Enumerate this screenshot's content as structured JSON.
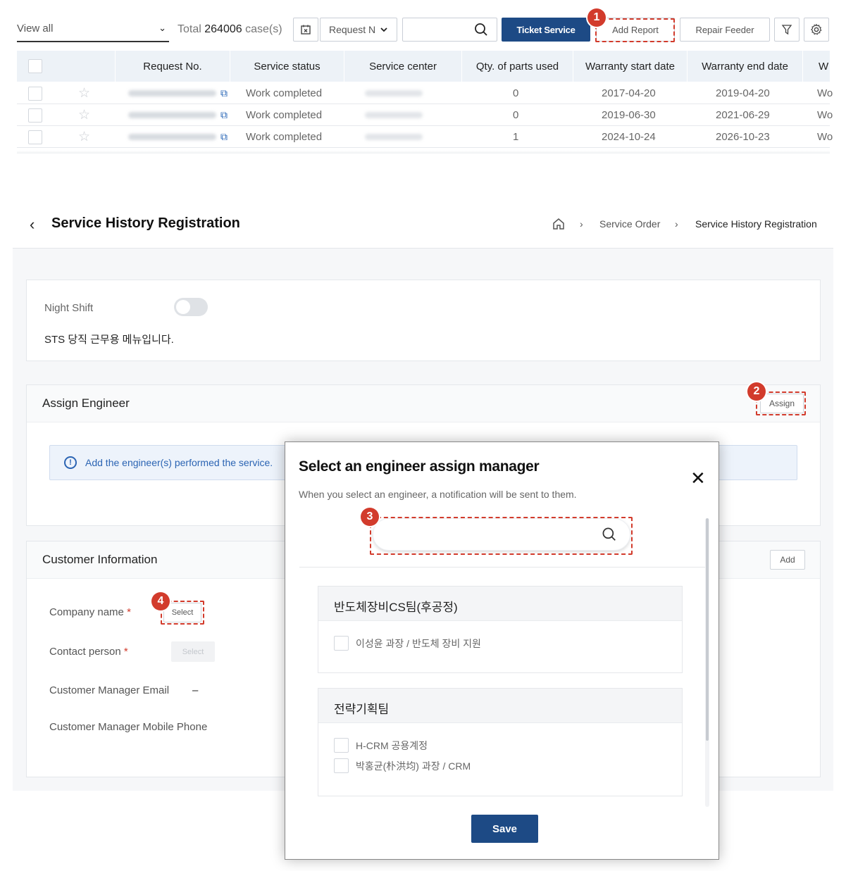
{
  "list": {
    "view_select": "View all",
    "total_prefix": "Total",
    "total_count": "264006",
    "total_suffix": "case(s)",
    "search_field_select": "Request N",
    "ticket_service": "Ticket Service",
    "add_report": "Add Report",
    "repair_feeder": "Repair Feeder",
    "columns": [
      "Request No.",
      "Service status",
      "Service center",
      "Qty. of parts used",
      "Warranty start date",
      "Warranty end date",
      "W"
    ],
    "rows": [
      {
        "status": "Work completed",
        "qty": "0",
        "start": "2017-04-20",
        "end": "2019-04-20",
        "w": "Wo"
      },
      {
        "status": "Work completed",
        "qty": "0",
        "start": "2019-06-30",
        "end": "2021-06-29",
        "w": "Wo"
      },
      {
        "status": "Work completed",
        "qty": "1",
        "start": "2024-10-24",
        "end": "2026-10-23",
        "w": "Wo"
      }
    ]
  },
  "registration": {
    "title": "Service History Registration",
    "breadcrumb": [
      "Service Order",
      "Service History Registration"
    ],
    "night_shift_label": "Night Shift",
    "night_shift_note": "STS 당직 근무용 메뉴입니다.",
    "assign_engineer_title": "Assign Engineer",
    "assign_button": "Assign",
    "info_text": "Add the engineer(s) performed the service.",
    "customer_info_title": "Customer Information",
    "add_button": "Add",
    "company_name_label": "Company name",
    "contact_person_label": "Contact person",
    "select_button": "Select",
    "customer_email_label": "Customer Manager Email",
    "customer_email_value": "–",
    "customer_phone_label": "Customer Manager Mobile Phone",
    "required_mark": "*"
  },
  "modal": {
    "title": "Select an engineer assign manager",
    "subtitle": "When you select an engineer, a notification will be sent to them.",
    "groups": [
      {
        "name": "반도체장비CS팀(후공정)",
        "members": [
          "이성윤 과장 / 반도체 장비 지원"
        ]
      },
      {
        "name": "전략기획팀",
        "members": [
          "H-CRM 공용계정",
          "박홍균(朴洪均) 과장 / CRM"
        ]
      }
    ],
    "save": "Save"
  },
  "annotations": [
    "1",
    "2",
    "3",
    "4"
  ],
  "colors": {
    "primary": "#1d4a85",
    "annotation": "#d23b2c",
    "info": "#2b64b3"
  }
}
